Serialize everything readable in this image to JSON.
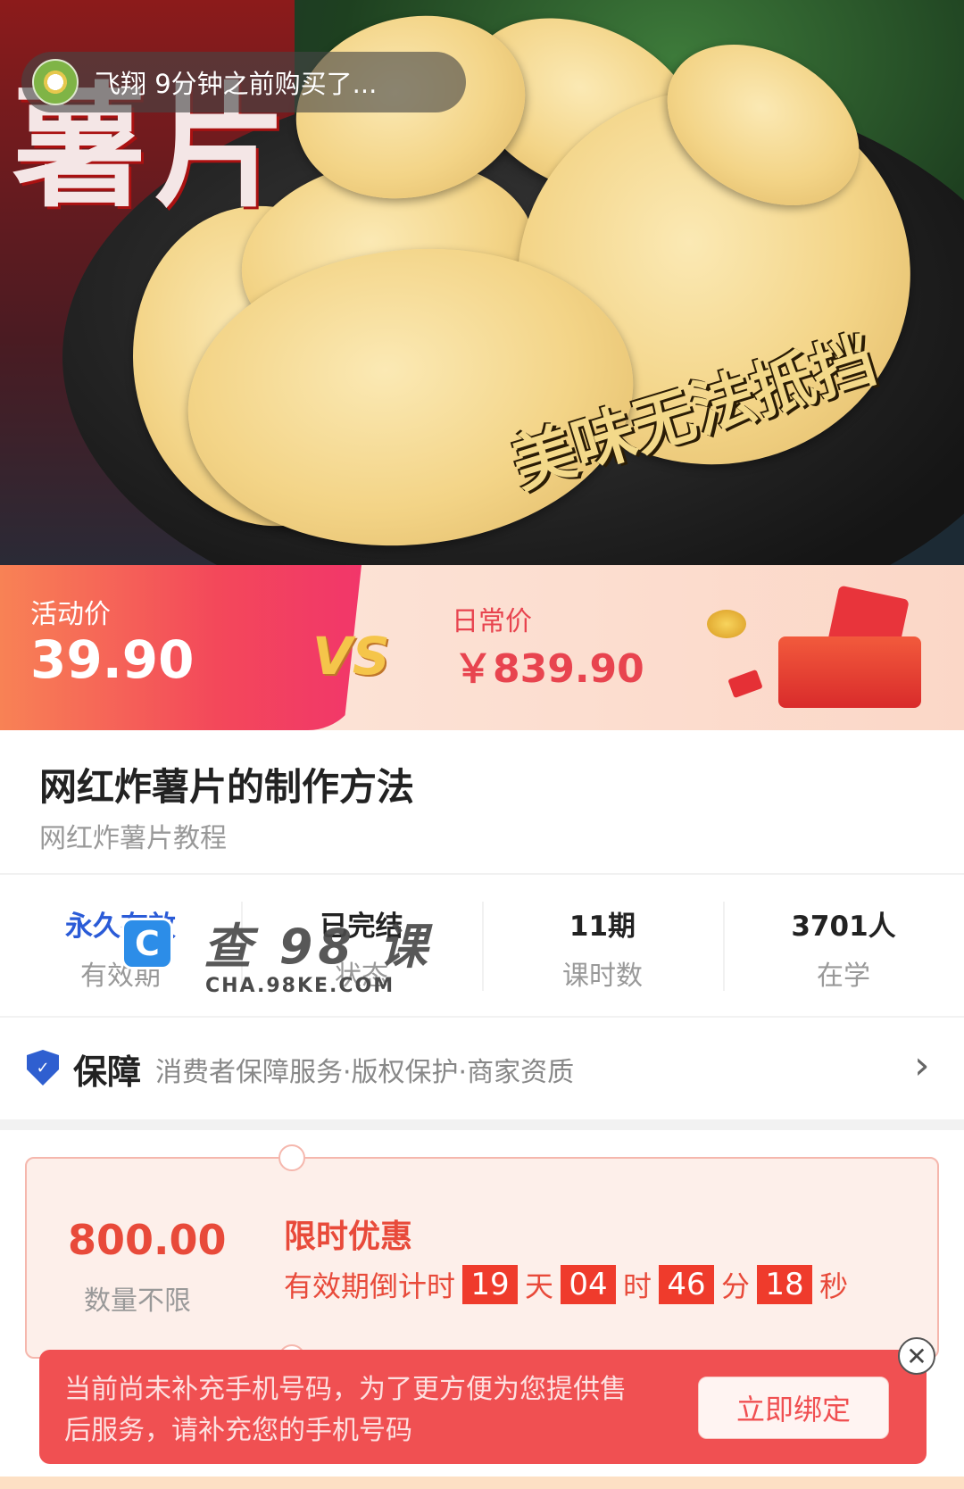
{
  "hero": {
    "title_chars": "薯片",
    "slogan": "美味无法抵挡",
    "purchase_notice": "飞翔 9分钟之前购买了..."
  },
  "price": {
    "promo_label": "活动价",
    "promo_value": "39.90",
    "vs": "VS",
    "normal_label": "日常价",
    "normal_value": "￥839.90"
  },
  "course": {
    "title": "网红炸薯片的制作方法",
    "subtitle": "网红炸薯片教程"
  },
  "stats": [
    {
      "value": "永久有效",
      "label": "有效期"
    },
    {
      "value": "已完结",
      "label": "状态"
    },
    {
      "value": "11期",
      "label": "课时数"
    },
    {
      "value": "3701人",
      "label": "在学"
    }
  ],
  "watermark": {
    "text": "查 98 课",
    "url": "CHA.98KE.COM"
  },
  "guarantee": {
    "title": "保障",
    "desc": "消费者保障服务·版权保护·商家资质"
  },
  "coupon": {
    "amount": "800.00",
    "quantity": "数量不限",
    "title": "限时优惠",
    "countdown_label": "有效期倒计时",
    "days": "19",
    "days_unit": "天",
    "hours": "04",
    "hours_unit": "时",
    "minutes": "46",
    "minutes_unit": "分",
    "seconds": "18",
    "seconds_unit": "秒"
  },
  "phone_banner": {
    "message": "当前尚未补充手机号码，为了更方便为您提供售后服务，请补充您的手机号码",
    "button": "立即绑定"
  },
  "colors": {
    "accent_red": "#e84a3a",
    "stat_blue": "#2a5bd7",
    "shield_blue": "#2f5fd0"
  }
}
